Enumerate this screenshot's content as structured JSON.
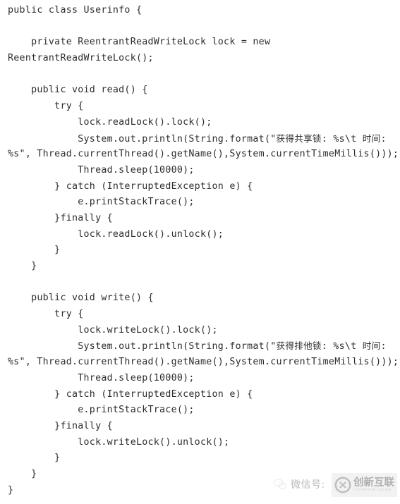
{
  "document": {
    "language": "java",
    "background_color": "#ffffff",
    "text_color": "#2d2d2d",
    "lines": [
      "public class Userinfo {",
      "",
      "    private ReentrantReadWriteLock lock = new",
      "ReentrantReadWriteLock();",
      "",
      "    public void read() {",
      "        try {",
      "            lock.readLock().lock();",
      "            System.out.println(String.format(\"获得共享锁: %s\\t 时间:",
      "%s\", Thread.currentThread().getName(),System.currentTimeMillis()));",
      "            Thread.sleep(10000);",
      "        } catch (InterruptedException e) {",
      "            e.printStackTrace();",
      "        }finally {",
      "            lock.readLock().unlock();",
      "        }",
      "    }",
      "",
      "    public void write() {",
      "        try {",
      "            lock.writeLock().lock();",
      "            System.out.println(String.format(\"获得排他锁: %s\\t 时间:",
      "%s\", Thread.currentThread().getName(),System.currentTimeMillis()));",
      "            Thread.sleep(10000);",
      "        } catch (InterruptedException e) {",
      "            e.printStackTrace();",
      "        }finally {",
      "            lock.writeLock().unlock();",
      "        }",
      "    }",
      "}"
    ]
  },
  "watermark": {
    "icon": "wechat-icon",
    "label": "微信号:",
    "color": "#b9b9b9"
  },
  "logo": {
    "mark": "cx-circle-icon",
    "title": "创新互联",
    "subtitle": "CHUANGXIN HULIAN",
    "color": "#b0b0b0",
    "background": "#f2f2f2"
  }
}
